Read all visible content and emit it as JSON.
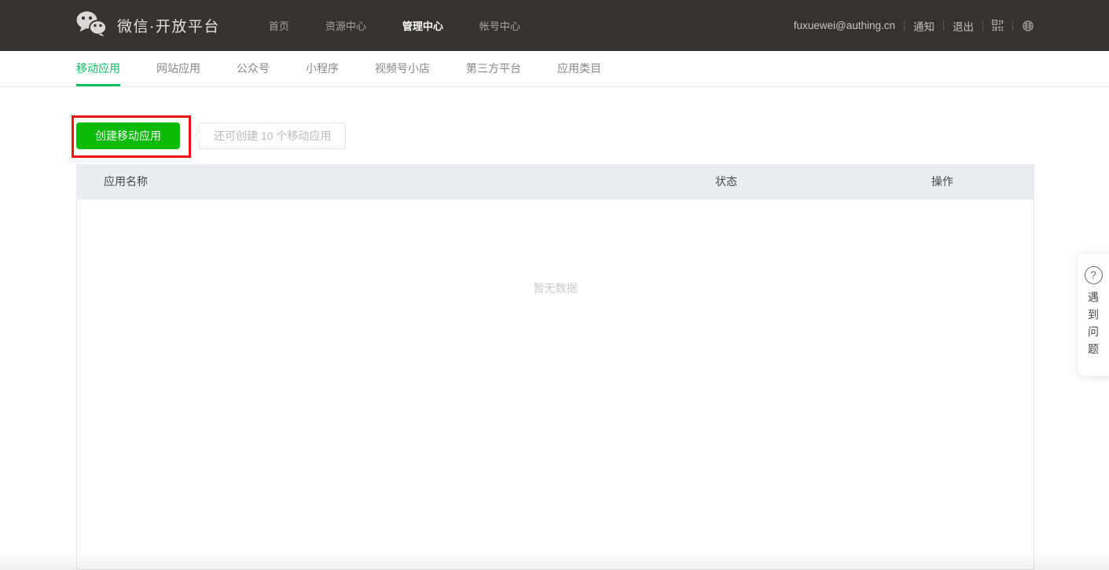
{
  "header": {
    "brand": {
      "logo_icon": "wechat-logo-icon",
      "title": "微信·开放平台"
    },
    "nav": [
      {
        "label": "首页",
        "active": false
      },
      {
        "label": "资源中心",
        "active": false
      },
      {
        "label": "管理中心",
        "active": true
      },
      {
        "label": "帐号中心",
        "active": false
      }
    ],
    "user": {
      "email": "fuxuewei@authing.cn",
      "notifications_label": "通知",
      "logout_label": "退出",
      "qr_icon": "qr-code-icon",
      "language_icon": "globe-icon"
    }
  },
  "tabs": [
    {
      "label": "移动应用",
      "active": true
    },
    {
      "label": "网站应用",
      "active": false
    },
    {
      "label": "公众号",
      "active": false
    },
    {
      "label": "小程序",
      "active": false
    },
    {
      "label": "视频号小店",
      "active": false
    },
    {
      "label": "第三方平台",
      "active": false
    },
    {
      "label": "应用类目",
      "active": false
    }
  ],
  "toolbar": {
    "create_button_label": "创建移动应用",
    "quota_hint": "还可创建 10 个移动应用"
  },
  "table": {
    "columns": [
      "应用名称",
      "状态",
      "操作"
    ],
    "rows": [],
    "empty_text": "暂无数据"
  },
  "help_widget": {
    "icon_glyph": "?",
    "label": "遇到问题"
  },
  "annotation": {
    "type": "highlight-box",
    "color": "#ec1313"
  },
  "colors": {
    "header_bg": "#36322e",
    "brand_green": "#07c160",
    "button_green": "#09bb07",
    "table_header_bg": "#eaedf1",
    "annotation_red": "#ec1313"
  }
}
